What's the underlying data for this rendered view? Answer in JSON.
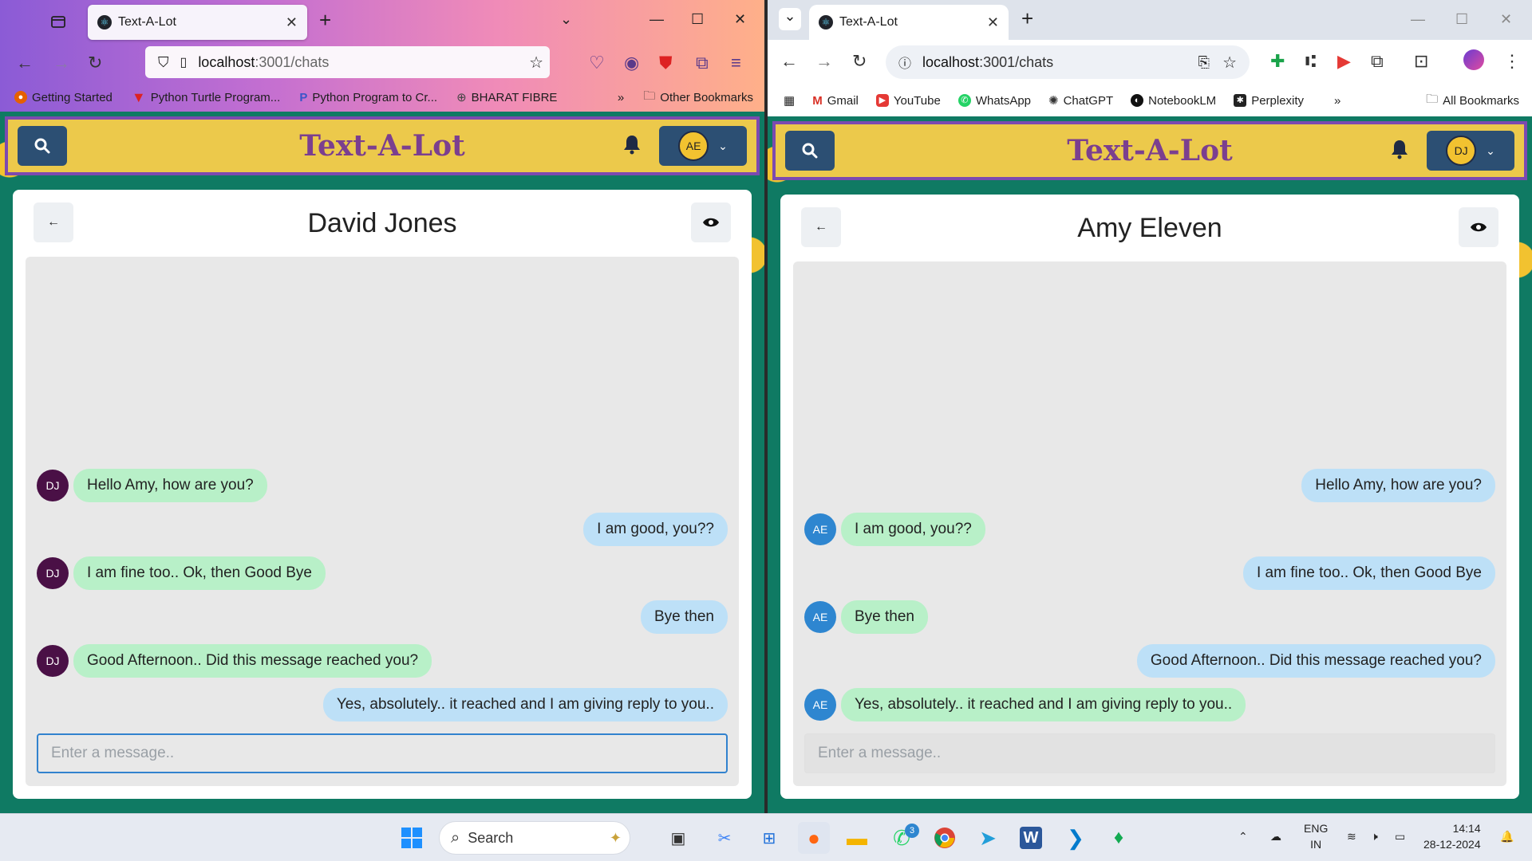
{
  "left_window": {
    "browser": "Firefox",
    "tab": {
      "title": "Text-A-Lot"
    },
    "url": {
      "host": "localhost",
      "path": ":3001/chats"
    },
    "bookmarks": [
      "Getting Started",
      "Python Turtle Program...",
      "Python Program to Cr...",
      "BHARAT FIBRE"
    ],
    "bookmarks_overflow": "»",
    "other_bookmarks": "Other Bookmarks",
    "app": {
      "title": "Text-A-Lot",
      "user_initials": "AE",
      "chat_name": "David Jones",
      "placeholder": "Enter a message..",
      "messages": [
        {
          "side": "in",
          "initials": "DJ",
          "text": "Hello Amy, how are you?"
        },
        {
          "side": "out",
          "text": "I am good, you??"
        },
        {
          "side": "in",
          "initials": "DJ",
          "text": "I am fine too.. Ok, then Good Bye"
        },
        {
          "side": "out",
          "text": "Bye then"
        },
        {
          "side": "in",
          "initials": "DJ",
          "text": "Good Afternoon.. Did this message reached you?"
        },
        {
          "side": "out",
          "text": "Yes, absolutely.. it reached and I am giving reply to you.."
        }
      ]
    }
  },
  "right_window": {
    "browser": "Chrome",
    "tab": {
      "title": "Text-A-Lot"
    },
    "url": {
      "host": "localhost",
      "path": ":3001/chats"
    },
    "bookmarks": [
      "Gmail",
      "YouTube",
      "WhatsApp",
      "ChatGPT",
      "NotebookLM",
      "Perplexity"
    ],
    "bookmarks_overflow": "»",
    "all_bookmarks": "All Bookmarks",
    "app": {
      "title": "Text-A-Lot",
      "user_initials": "DJ",
      "chat_name": "Amy Eleven",
      "placeholder": "Enter a message..",
      "messages": [
        {
          "side": "out",
          "text": "Hello Amy, how are you?"
        },
        {
          "side": "in",
          "initials": "AE",
          "text": "I am good, you??"
        },
        {
          "side": "out",
          "text": "I am fine too.. Ok, then Good Bye"
        },
        {
          "side": "in",
          "initials": "AE",
          "text": "Bye then"
        },
        {
          "side": "out",
          "text": "Good Afternoon.. Did this message reached you?"
        },
        {
          "side": "in",
          "initials": "AE",
          "text": "Yes, absolutely.. it reached and I am giving reply to you.."
        }
      ]
    }
  },
  "taskbar": {
    "search_label": "Search",
    "whatsapp_badge": "3",
    "language": "ENG",
    "region": "IN",
    "time": "14:14",
    "date": "28-12-2024"
  },
  "colors": {
    "header_bg": "#ecc94b",
    "header_border": "#7c4ab0",
    "title_color": "#7b3f8f",
    "button_bg": "#2c4f73",
    "incoming_bubble": "#b8f0c8",
    "outgoing_bubble": "#bde0f7",
    "dj_avatar": "#4a1046",
    "ae_avatar": "#2e86d0"
  }
}
